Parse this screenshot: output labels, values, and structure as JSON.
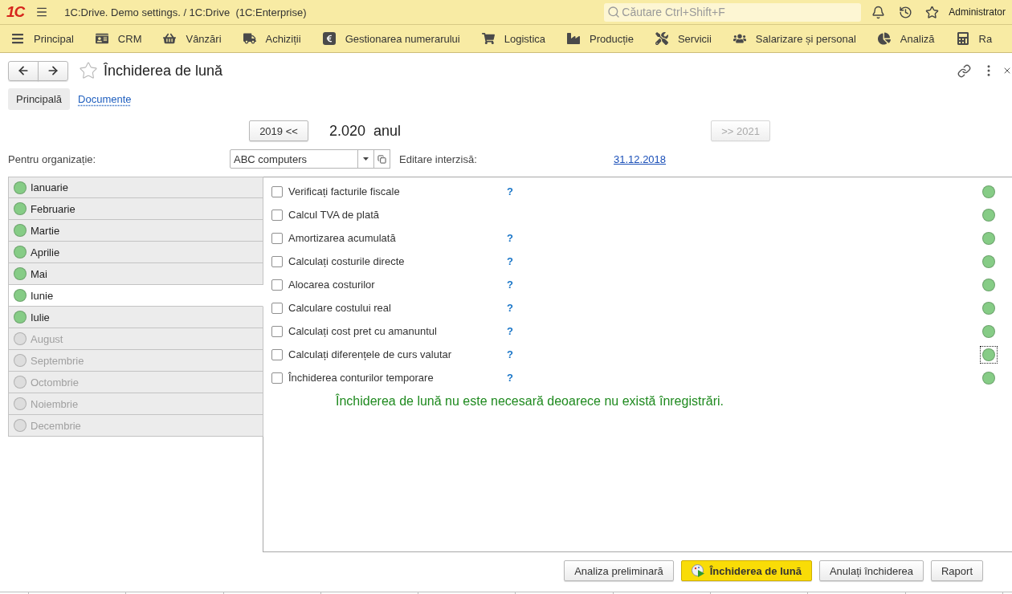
{
  "app": {
    "logo": "1C",
    "title": "1C:Drive. Demo settings. / 1C:Drive  (1C:Enterprise)",
    "search": {
      "placeholder": "Căutare Ctrl+Shift+F"
    },
    "user": "Administrator"
  },
  "menu": [
    {
      "label": "Principal"
    },
    {
      "label": "CRM"
    },
    {
      "label": "Vânzări"
    },
    {
      "label": "Achiziții"
    },
    {
      "label": "Gestionarea numerarului"
    },
    {
      "label": "Logistica"
    },
    {
      "label": "Producție"
    },
    {
      "label": "Servicii"
    },
    {
      "label": "Salarizare și personal"
    },
    {
      "label": "Analiză"
    },
    {
      "label": "Ra"
    }
  ],
  "page": {
    "title": "Închiderea de lună",
    "favorite": false
  },
  "tabs": [
    {
      "label": "Principală",
      "selected": true
    },
    {
      "label": "Documente",
      "selected": false
    }
  ],
  "year_nav": {
    "previous": {
      "label": "2019 <<",
      "disabled": false
    },
    "current": "2.020  anul",
    "next": {
      "label": ">> 2021",
      "disabled": true
    }
  },
  "organization": {
    "label": "Pentru organizație:",
    "value": "ABC computers"
  },
  "edit_lock": {
    "label": "Editare interzisă:",
    "date": "31.12.2018"
  },
  "months": [
    {
      "label": "Ianuarie",
      "selected": false,
      "disabled": false,
      "color": "#86cc86"
    },
    {
      "label": "Februarie",
      "selected": false,
      "disabled": false,
      "color": "#86cc86"
    },
    {
      "label": "Martie",
      "selected": false,
      "disabled": false,
      "color": "#86cc86"
    },
    {
      "label": "Aprilie",
      "selected": false,
      "disabled": false,
      "color": "#86cc86"
    },
    {
      "label": "Mai",
      "selected": false,
      "disabled": false,
      "color": "#86cc86"
    },
    {
      "label": "Iunie",
      "selected": true,
      "disabled": false,
      "color": "#86cc86"
    },
    {
      "label": "Iulie",
      "selected": false,
      "disabled": false,
      "color": "#86cc86"
    },
    {
      "label": "August",
      "selected": false,
      "disabled": true,
      "color": "#dddddd"
    },
    {
      "label": "Septembrie",
      "selected": false,
      "disabled": true,
      "color": "#dddddd"
    },
    {
      "label": "Octombrie",
      "selected": false,
      "disabled": true,
      "color": "#dddddd"
    },
    {
      "label": "Noiembrie",
      "selected": false,
      "disabled": true,
      "color": "#dddddd"
    },
    {
      "label": "Decembrie",
      "selected": false,
      "disabled": true,
      "color": "#dddddd"
    }
  ],
  "tasks": [
    {
      "label": "Verificați facturile fiscale",
      "checked": false,
      "help": "?",
      "color": "#86cc86",
      "focused": false
    },
    {
      "label": "Calcul TVA de plată",
      "checked": false,
      "color": "#86cc86",
      "focused": false
    },
    {
      "label": "Amortizarea acumulată",
      "checked": false,
      "help": "?",
      "color": "#86cc86",
      "focused": false
    },
    {
      "label": "Calculați costurile directe",
      "checked": false,
      "help": "?",
      "color": "#86cc86",
      "focused": false
    },
    {
      "label": "Alocarea costurilor",
      "checked": false,
      "help": "?",
      "color": "#86cc86",
      "focused": false
    },
    {
      "label": "Calculare costului real",
      "checked": false,
      "help": "?",
      "color": "#86cc86",
      "focused": false
    },
    {
      "label": "Calculați cost pret cu amanuntul",
      "checked": false,
      "help": "?",
      "color": "#86cc86",
      "focused": false
    },
    {
      "label": "Calculați diferențele de curs valutar",
      "checked": false,
      "help": "?",
      "color": "#86cc86",
      "focused": true
    },
    {
      "label": "Închiderea conturilor temporare",
      "checked": false,
      "help": "?",
      "color": "#86cc86",
      "focused": false
    }
  ],
  "message": "Închiderea de lună nu este necesară deoarece nu există înregistrări.",
  "actions": [
    {
      "label": "Analiza preliminară",
      "kind": "default"
    },
    {
      "label": "Închiderea de lună",
      "kind": "primary"
    },
    {
      "label": "Anulați închiderea",
      "kind": "default"
    },
    {
      "label": "Raport",
      "kind": "default"
    }
  ]
}
